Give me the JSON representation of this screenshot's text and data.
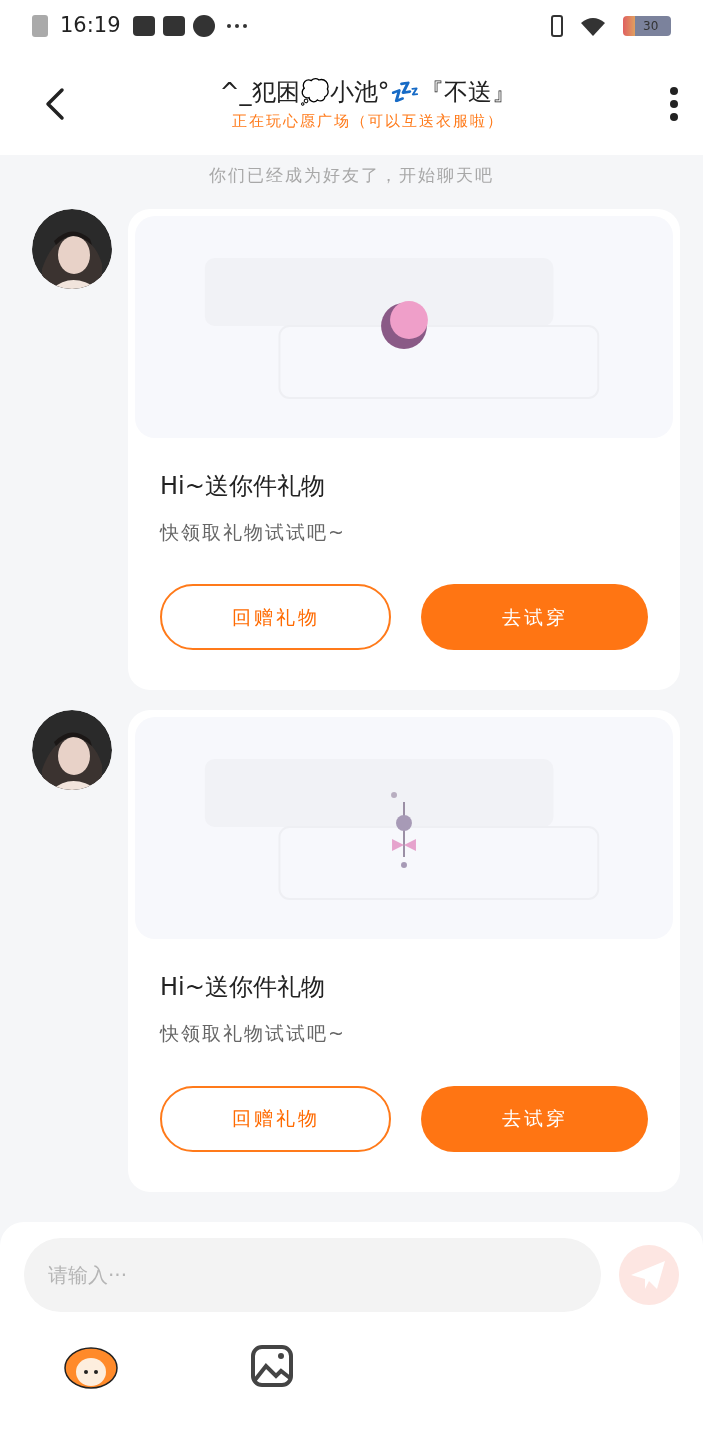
{
  "status_bar": {
    "time": "16:19",
    "battery": "30"
  },
  "header": {
    "title": "^_犯困💭小池°💤『不送』",
    "subtitle": "正在玩心愿广场（可以互送衣服啦）"
  },
  "system_notice": "你们已经成为好友了，开始聊天吧",
  "messages": [
    {
      "title": "Hi~送你件礼物",
      "text": "快领取礼物试试吧~",
      "buttons": [
        {
          "label": "回赠礼物",
          "kind": "outline"
        },
        {
          "label": "去试穿",
          "kind": "filled"
        }
      ]
    },
    {
      "title": "Hi~送你件礼物",
      "text": "快领取礼物试试吧~",
      "buttons": [
        {
          "label": "回赠礼物",
          "kind": "outline"
        },
        {
          "label": "去试穿",
          "kind": "filled"
        }
      ]
    }
  ],
  "composer": {
    "placeholder": "请输入···"
  }
}
